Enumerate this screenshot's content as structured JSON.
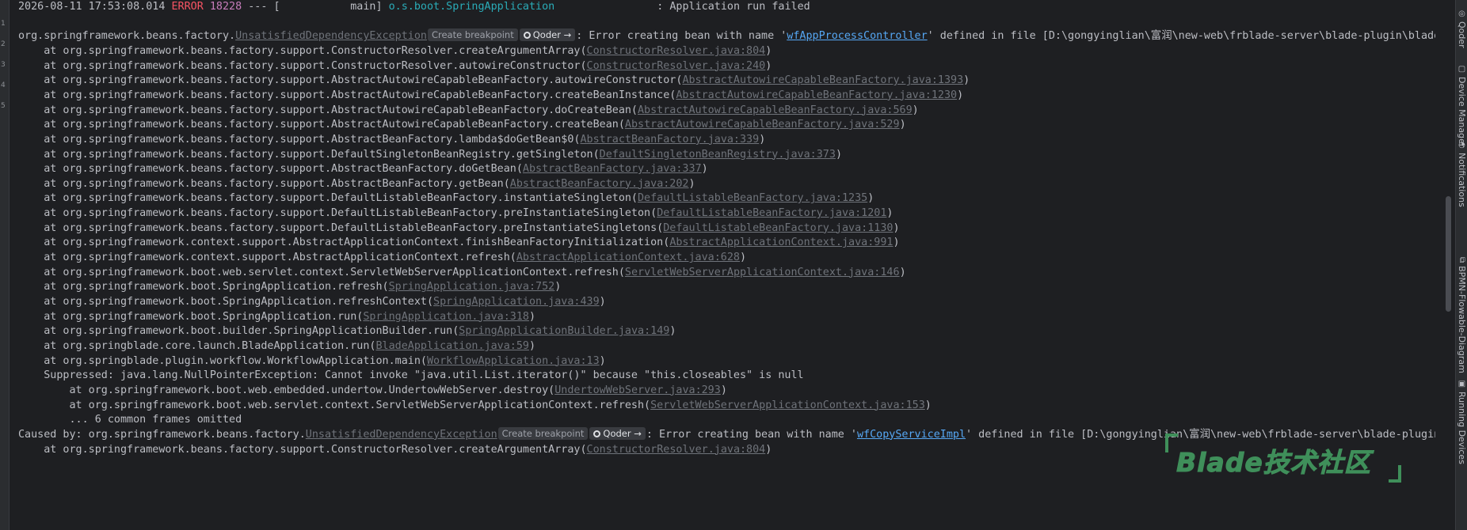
{
  "left_gutter": {
    "glyphs": [
      "1",
      "2",
      "3",
      "4",
      "5"
    ]
  },
  "console": {
    "header": {
      "timestamp": "2026-08-11 17:53:08.014",
      "level": "ERROR",
      "pid": "18228",
      "sep": " --- [",
      "thread": "           main]",
      "logger": "o.s.boot.SpringApplication",
      "message": "                : Application run failed"
    },
    "exception": {
      "prefix": "org.springframework.beans.factory.",
      "class": "UnsatisfiedDependencyException",
      "breakpoint_label": "Create breakpoint",
      "qoder_label": "Qoder →",
      "msg_pre": ": Error creating bean with name '",
      "bean": "wfAppProcessController",
      "msg_post": "' defined in file [D:\\gongyinglian\\富润\\new-web\\frblade-server\\blade-plugin\\blade-w"
    },
    "frames": [
      {
        "text": "    at org.springframework.beans.factory.support.ConstructorResolver.createArgumentArray(",
        "link": "ConstructorResolver.java:804",
        "close": ")"
      },
      {
        "text": "    at org.springframework.beans.factory.support.ConstructorResolver.autowireConstructor(",
        "link": "ConstructorResolver.java:240",
        "close": ")"
      },
      {
        "text": "    at org.springframework.beans.factory.support.AbstractAutowireCapableBeanFactory.autowireConstructor(",
        "link": "AbstractAutowireCapableBeanFactory.java:1393",
        "close": ")"
      },
      {
        "text": "    at org.springframework.beans.factory.support.AbstractAutowireCapableBeanFactory.createBeanInstance(",
        "link": "AbstractAutowireCapableBeanFactory.java:1230",
        "close": ")"
      },
      {
        "text": "    at org.springframework.beans.factory.support.AbstractAutowireCapableBeanFactory.doCreateBean(",
        "link": "AbstractAutowireCapableBeanFactory.java:569",
        "close": ")"
      },
      {
        "text": "    at org.springframework.beans.factory.support.AbstractAutowireCapableBeanFactory.createBean(",
        "link": "AbstractAutowireCapableBeanFactory.java:529",
        "close": ")"
      },
      {
        "text": "    at org.springframework.beans.factory.support.AbstractBeanFactory.lambda$doGetBean$0(",
        "link": "AbstractBeanFactory.java:339",
        "close": ")"
      },
      {
        "text": "    at org.springframework.beans.factory.support.DefaultSingletonBeanRegistry.getSingleton(",
        "link": "DefaultSingletonBeanRegistry.java:373",
        "close": ")"
      },
      {
        "text": "    at org.springframework.beans.factory.support.AbstractBeanFactory.doGetBean(",
        "link": "AbstractBeanFactory.java:337",
        "close": ")"
      },
      {
        "text": "    at org.springframework.beans.factory.support.AbstractBeanFactory.getBean(",
        "link": "AbstractBeanFactory.java:202",
        "close": ")"
      },
      {
        "text": "    at org.springframework.beans.factory.support.DefaultListableBeanFactory.instantiateSingleton(",
        "link": "DefaultListableBeanFactory.java:1235",
        "close": ")"
      },
      {
        "text": "    at org.springframework.beans.factory.support.DefaultListableBeanFactory.preInstantiateSingleton(",
        "link": "DefaultListableBeanFactory.java:1201",
        "close": ")"
      },
      {
        "text": "    at org.springframework.beans.factory.support.DefaultListableBeanFactory.preInstantiateSingletons(",
        "link": "DefaultListableBeanFactory.java:1130",
        "close": ")"
      },
      {
        "text": "    at org.springframework.context.support.AbstractApplicationContext.finishBeanFactoryInitialization(",
        "link": "AbstractApplicationContext.java:991",
        "close": ")"
      },
      {
        "text": "    at org.springframework.context.support.AbstractApplicationContext.refresh(",
        "link": "AbstractApplicationContext.java:628",
        "close": ")"
      },
      {
        "text": "    at org.springframework.boot.web.servlet.context.ServletWebServerApplicationContext.refresh(",
        "link": "ServletWebServerApplicationContext.java:146",
        "close": ")"
      },
      {
        "text": "    at org.springframework.boot.SpringApplication.refresh(",
        "link": "SpringApplication.java:752",
        "close": ")"
      },
      {
        "text": "    at org.springframework.boot.SpringApplication.refreshContext(",
        "link": "SpringApplication.java:439",
        "close": ")"
      },
      {
        "text": "    at org.springframework.boot.SpringApplication.run(",
        "link": "SpringApplication.java:318",
        "close": ")"
      },
      {
        "text": "    at org.springframework.boot.builder.SpringApplicationBuilder.run(",
        "link": "SpringApplicationBuilder.java:149",
        "close": ")"
      },
      {
        "text": "    at org.springblade.core.launch.BladeApplication.run(",
        "link": "BladeApplication.java:59",
        "close": ")"
      },
      {
        "text": "    at org.springblade.plugin.workflow.WorkflowApplication.main(",
        "link": "WorkflowApplication.java:13",
        "close": ")"
      }
    ],
    "suppressed": "    Suppressed: java.lang.NullPointerException: Cannot invoke \"java.util.List.iterator()\" because \"this.closeables\" is null",
    "suppressed_frames": [
      {
        "text": "        at org.springframework.boot.web.embedded.undertow.UndertowWebServer.destroy(",
        "link": "UndertowWebServer.java:293",
        "close": ")"
      },
      {
        "text": "        at org.springframework.boot.web.servlet.context.ServletWebServerApplicationContext.refresh(",
        "link": "ServletWebServerApplicationContext.java:153",
        "close": ")"
      }
    ],
    "omitted": "        ... 6 common frames omitted",
    "caused_by": {
      "prefix": "Caused by: org.springframework.beans.factory.",
      "class": "UnsatisfiedDependencyException",
      "breakpoint_label": "Create breakpoint",
      "qoder_label": "Qoder →",
      "msg_pre": ": Error creating bean with name '",
      "bean": "wfCopyServiceImpl",
      "msg_post": "' defined in file [D:\\gongyinglian\\富润\\new-web\\frblade-server\\blade-plugin\\b"
    },
    "last_partial": {
      "text": "    at org.springframework.beans.factory.support.ConstructorResolver.createArgumentArray(",
      "link": "ConstructorResolver.java:804",
      "close": ")"
    }
  },
  "right_tabs": [
    {
      "label": "Qoder",
      "icon": "qoder-icon"
    },
    {
      "label": "Device Manager",
      "icon": "device-manager-icon"
    },
    {
      "label": "Notifications",
      "icon": "bell-icon"
    },
    {
      "label": "BPMN-Flowable-Diagram",
      "icon": "diagram-icon"
    },
    {
      "label": "Running Devices",
      "icon": "running-devices-icon"
    }
  ],
  "watermark": {
    "text": "Blade技术社区"
  },
  "colors": {
    "background": "#1e1f22",
    "text": "#bcbec4",
    "error": "#f75464",
    "pid": "#c77dbb",
    "logger": "#2aacb8",
    "link_blue": "#56a8f5",
    "watermark": "#3f8f5a"
  }
}
